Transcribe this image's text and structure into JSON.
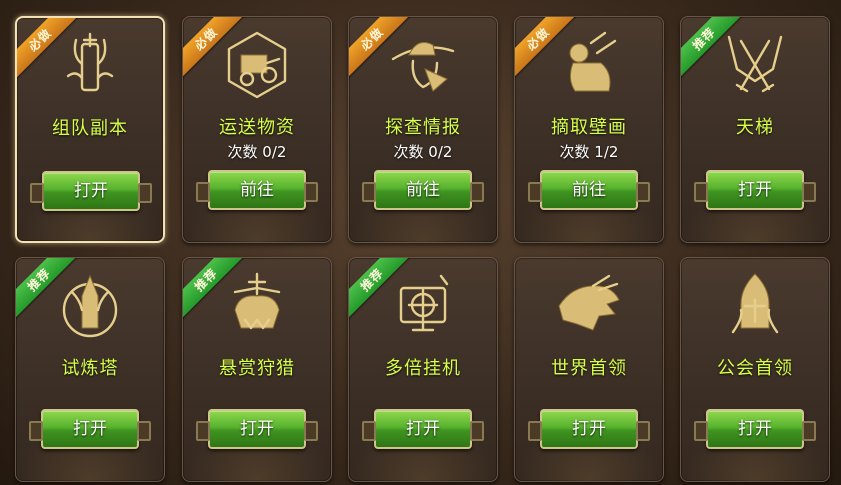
{
  "cards": [
    {
      "title": "组队副本",
      "count": "",
      "button": "打开",
      "tag": "必做",
      "tag_type": "must",
      "icon": "helmet-emblem-icon",
      "selected": true
    },
    {
      "title": "运送物资",
      "count": "次数 0/2",
      "button": "前往",
      "tag": "必做",
      "tag_type": "must",
      "icon": "supply-cart-icon",
      "selected": false
    },
    {
      "title": "探查情报",
      "count": "次数 0/2",
      "button": "前往",
      "tag": "必做",
      "tag_type": "must",
      "icon": "spy-hat-icon",
      "selected": false
    },
    {
      "title": "摘取壁画",
      "count": "次数 1/2",
      "button": "前往",
      "tag": "必做",
      "tag_type": "must",
      "icon": "mural-thief-icon",
      "selected": false
    },
    {
      "title": "天梯",
      "count": "",
      "button": "打开",
      "tag": "推荐",
      "tag_type": "rec",
      "icon": "crossed-swords-icon",
      "selected": false
    },
    {
      "title": "试炼塔",
      "count": "",
      "button": "打开",
      "tag": "推荐",
      "tag_type": "rec",
      "icon": "horned-helmet-icon",
      "selected": false
    },
    {
      "title": "悬赏狩猎",
      "count": "",
      "button": "打开",
      "tag": "推荐",
      "tag_type": "rec",
      "icon": "beast-skull-icon",
      "selected": false
    },
    {
      "title": "多倍挂机",
      "count": "",
      "button": "打开",
      "tag": "推荐",
      "tag_type": "rec",
      "icon": "target-monitor-icon",
      "selected": false
    },
    {
      "title": "世界首领",
      "count": "",
      "button": "打开",
      "tag": "",
      "tag_type": "",
      "icon": "dragon-head-icon",
      "selected": false
    },
    {
      "title": "公会首领",
      "count": "",
      "button": "打开",
      "tag": "",
      "tag_type": "",
      "icon": "knight-helm-icon",
      "selected": false
    }
  ],
  "colors": {
    "title": "#d6ff47",
    "must": "#e8981f",
    "rec": "#3fb43f",
    "button": "#4fa527"
  }
}
